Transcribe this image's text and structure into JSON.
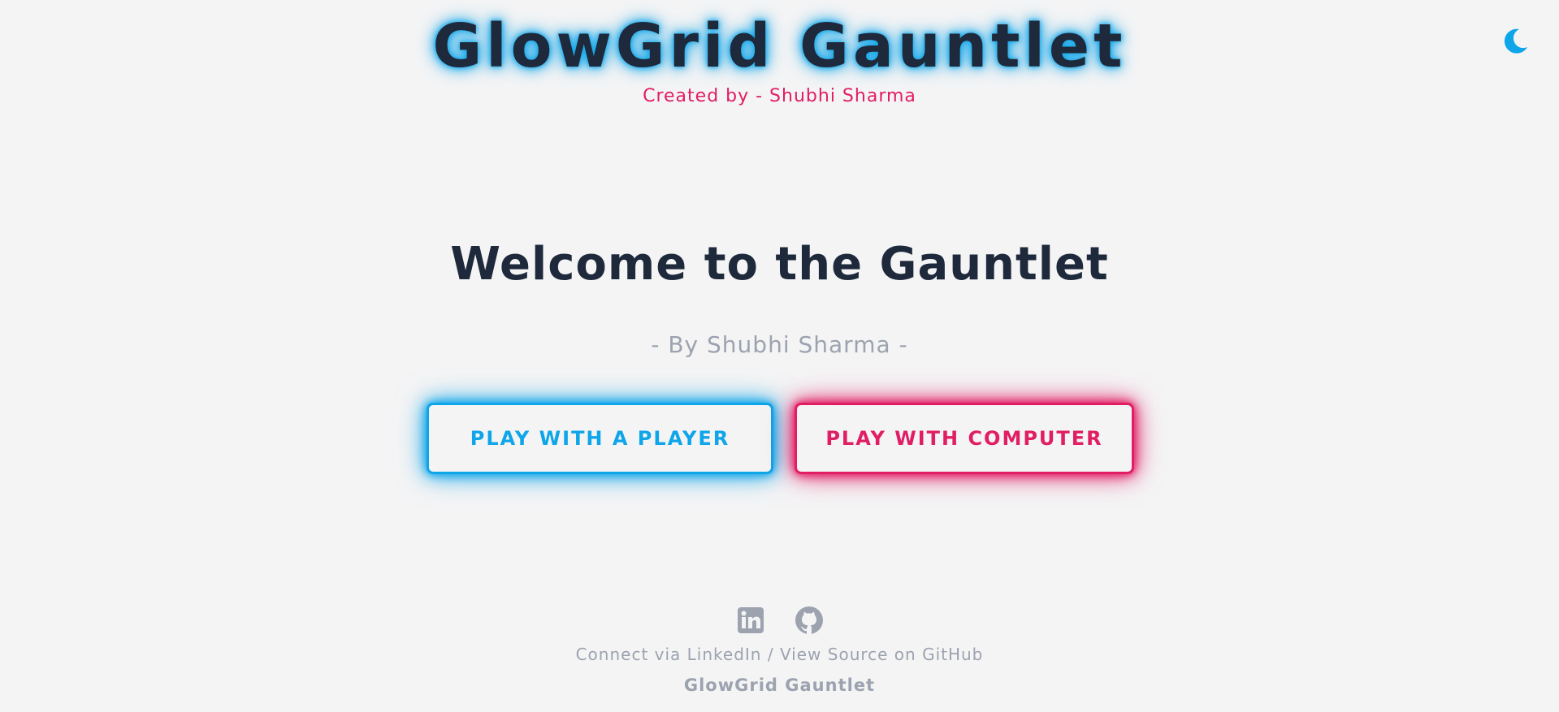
{
  "header": {
    "title": "GlowGrid Gauntlet",
    "creator": "Created by - Shubhi Sharma",
    "theme_toggle_icon": "moon-icon"
  },
  "main": {
    "heading": "Welcome to the Gauntlet",
    "byline": "- By Shubhi Sharma -",
    "buttons": {
      "player": "PLAY WITH A PLAYER",
      "computer": "PLAY WITH COMPUTER"
    }
  },
  "footer": {
    "icons": [
      "linkedin-icon",
      "github-icon"
    ],
    "linkedin_text": "Connect via LinkedIn",
    "separator": " / ",
    "github_text": "View Source on GitHub",
    "brand": "GlowGrid Gauntlet"
  },
  "colors": {
    "background": "#f4f4f5",
    "accent_blue": "#0ea5e9",
    "accent_pink": "#e11d63",
    "text_dark": "#1e293b",
    "text_muted": "#9ca3af"
  }
}
